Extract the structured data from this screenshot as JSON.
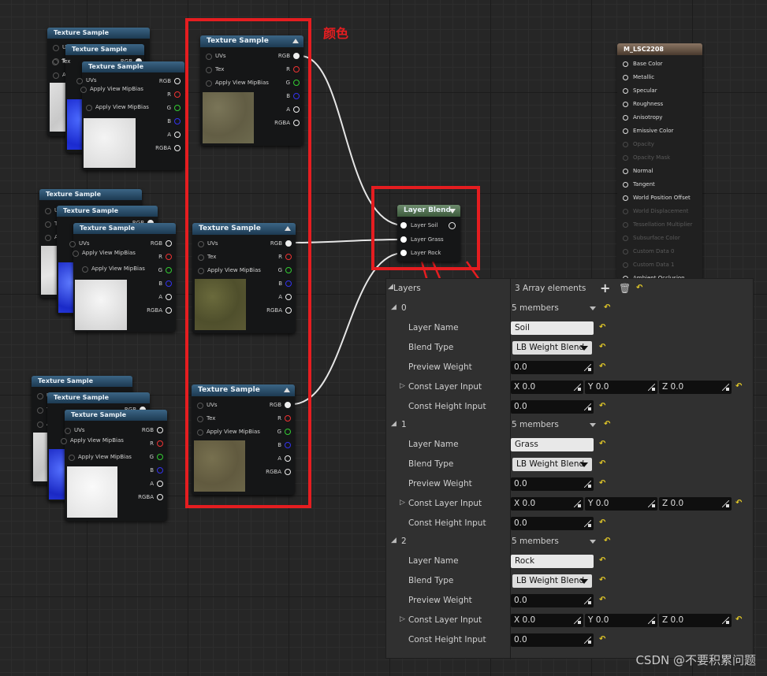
{
  "colors": {
    "accent_red": "#e51d20",
    "node_header": "#2e5575",
    "panel_bg": "#303030",
    "wire": "#e0e0e0"
  },
  "annotations": {
    "color_label": "颜色"
  },
  "texture_node": {
    "title": "Texture Sample",
    "uvs": "UVs",
    "tex": "Tex",
    "mip": "Apply View MipBias",
    "rgb": "RGB",
    "r": "R",
    "g": "G",
    "b": "B",
    "a": "A",
    "rgba": "RGBA"
  },
  "layer_blend": {
    "title": "Layer Blend",
    "inputs": [
      "Layer Soil",
      "Layer Grass",
      "Layer Rock"
    ]
  },
  "material": {
    "title": "M_LSC2208",
    "pins": [
      {
        "label": "Base Color",
        "enabled": true
      },
      {
        "label": "Metallic",
        "enabled": true
      },
      {
        "label": "Specular",
        "enabled": true
      },
      {
        "label": "Roughness",
        "enabled": true
      },
      {
        "label": "Anisotropy",
        "enabled": true
      },
      {
        "label": "Emissive Color",
        "enabled": true
      },
      {
        "label": "Opacity",
        "enabled": false
      },
      {
        "label": "Opacity Mask",
        "enabled": false
      },
      {
        "label": "Normal",
        "enabled": true
      },
      {
        "label": "Tangent",
        "enabled": true
      },
      {
        "label": "World Position Offset",
        "enabled": true
      },
      {
        "label": "World Displacement",
        "enabled": false
      },
      {
        "label": "Tessellation Multiplier",
        "enabled": false
      },
      {
        "label": "Subsurface Color",
        "enabled": false
      },
      {
        "label": "Custom Data 0",
        "enabled": false
      },
      {
        "label": "Custom Data 1",
        "enabled": false
      },
      {
        "label": "Ambient Occlusion",
        "enabled": true
      }
    ]
  },
  "details": {
    "header_label": "Layers",
    "header_value": "3 Array elements",
    "labels": {
      "layer_name": "Layer Name",
      "blend_type": "Blend Type",
      "preview_weight": "Preview Weight",
      "const_layer_input": "Const Layer Input",
      "const_height_input": "Const Height Input"
    },
    "members_text": "5 members",
    "layers": [
      {
        "index": "0",
        "name": "Soil",
        "blend": "LB Weight Blend",
        "weight": "0.0",
        "x": "X  0.0",
        "y": "Y  0.0",
        "z": "Z  0.0",
        "height": "0.0"
      },
      {
        "index": "1",
        "name": "Grass",
        "blend": "LB Weight Blend",
        "weight": "0.0",
        "x": "X  0.0",
        "y": "Y  0.0",
        "z": "Z  0.0",
        "height": "0.0"
      },
      {
        "index": "2",
        "name": "Rock",
        "blend": "LB Weight Blend",
        "weight": "0.0",
        "x": "X  0.0",
        "y": "Y  0.0",
        "z": "Z  0.0",
        "height": "0.0"
      }
    ]
  },
  "watermark": "CSDN @不要积累问题"
}
